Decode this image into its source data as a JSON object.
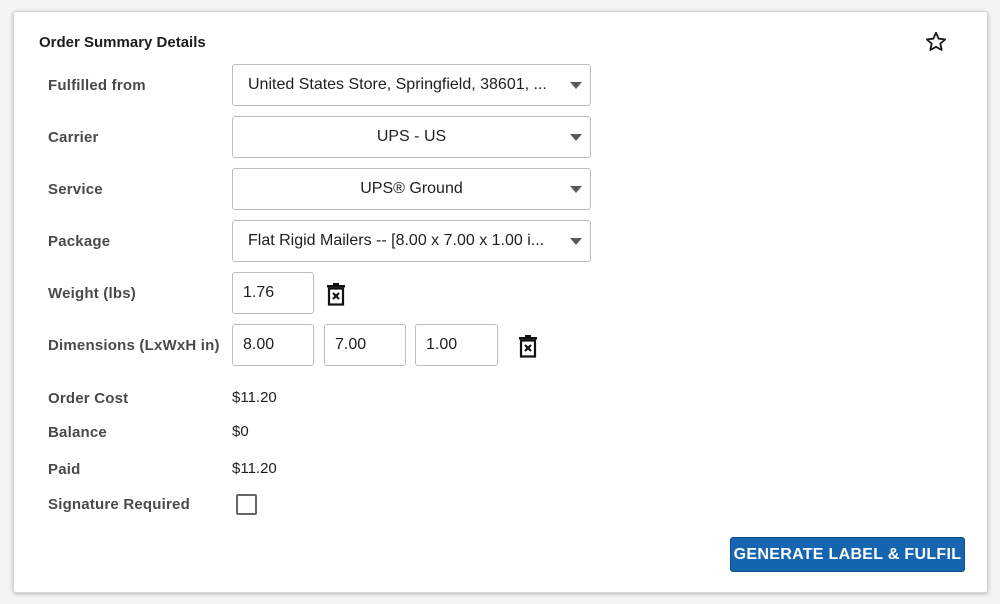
{
  "panel": {
    "title": "Order Summary Details",
    "favorite_icon": "star-outline-icon"
  },
  "fields": {
    "fulfilled_from": {
      "label": "Fulfilled from",
      "value": "United States Store, Springfield, 38601, ..."
    },
    "carrier": {
      "label": "Carrier",
      "value": "UPS - US"
    },
    "service": {
      "label": "Service",
      "value": "UPS® Ground"
    },
    "package": {
      "label": "Package",
      "value": "Flat Rigid Mailers -- [8.00 x 7.00 x 1.00 i..."
    },
    "weight": {
      "label": "Weight  (lbs)",
      "value": "1.76"
    },
    "dimensions": {
      "label": "Dimensions (LxWxH in)",
      "length": "8.00",
      "width": "7.00",
      "height": "1.00"
    }
  },
  "summary": {
    "order_cost": {
      "label": "Order Cost",
      "value": "$11.20"
    },
    "balance": {
      "label": "Balance",
      "value": "$0"
    },
    "paid": {
      "label": "Paid",
      "value": "$11.20"
    },
    "signature_required": {
      "label": "Signature Required",
      "checked": false
    }
  },
  "actions": {
    "generate_label": "GENERATE LABEL & FULFIL"
  },
  "colors": {
    "primary_button": "#1565b0",
    "label_text": "#4a4a4a"
  }
}
